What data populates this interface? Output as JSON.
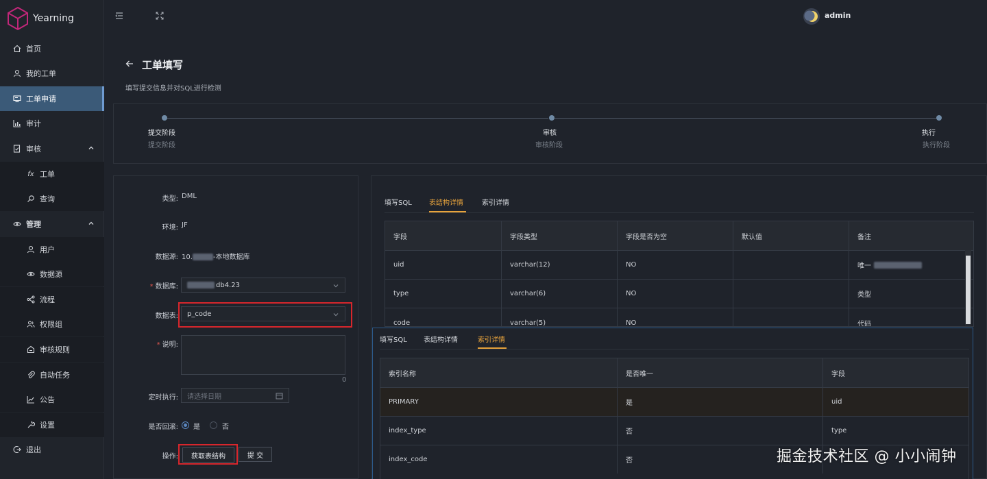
{
  "app": {
    "name": "Yearning"
  },
  "header": {
    "username": "admin"
  },
  "sidebar": {
    "items": [
      {
        "label": "首页",
        "icon": "home-icon"
      },
      {
        "label": "我的工单",
        "icon": "user-icon"
      },
      {
        "label": "工单申请",
        "icon": "monitor-icon",
        "active": true
      },
      {
        "label": "审计",
        "icon": "chart-icon"
      },
      {
        "label": "审核",
        "icon": "doc-check-icon",
        "expanded": true
      },
      {
        "label": "工单",
        "icon": "fx-icon",
        "sub": true
      },
      {
        "label": "查询",
        "icon": "search-icon",
        "sub": true
      },
      {
        "label": "管理",
        "icon": "eye-icon",
        "expanded": true
      },
      {
        "label": "用户",
        "icon": "user-icon",
        "sub": true
      },
      {
        "label": "数据源",
        "icon": "eye-icon",
        "sub": true
      },
      {
        "label": "流程",
        "icon": "flow-icon",
        "sub": true
      },
      {
        "label": "权限组",
        "icon": "group-icon",
        "sub": true
      },
      {
        "label": "审核规则",
        "icon": "rule-icon",
        "sub": true
      },
      {
        "label": "自动任务",
        "icon": "paperclip-icon",
        "sub": true
      },
      {
        "label": "公告",
        "icon": "chart-icon",
        "sub": true
      },
      {
        "label": "设置",
        "icon": "wrench-icon",
        "sub": true
      },
      {
        "label": "退出",
        "icon": "logout-icon"
      }
    ]
  },
  "page": {
    "title": "工单填写",
    "subtitle": "填写提交信息并对SQL进行检测"
  },
  "steps": [
    {
      "title": "提交阶段",
      "desc": "提交阶段"
    },
    {
      "title": "审核",
      "desc": "审核阶段"
    },
    {
      "title": "执行",
      "desc": "执行阶段"
    }
  ],
  "form": {
    "type_label": "类型:",
    "type_value": "DML",
    "env_label": "环境:",
    "env_value": "JF",
    "source_label": "数据源:",
    "source_prefix": "10.",
    "source_suffix": "-本地数据库",
    "db_label": "数据库:",
    "db_value_suffix": "db4.23",
    "table_label": "数据表:",
    "table_value": "p_code",
    "desc_label": "说明:",
    "desc_count": "0",
    "schedule_label": "定时执行:",
    "schedule_placeholder": "请选择日期",
    "rollback_label": "是否回滚:",
    "rollback_yes": "是",
    "rollback_no": "否",
    "action_label": "操作:",
    "fetch_button": "获取表结构",
    "submit_button": "提 交"
  },
  "tabs_main": {
    "tabs": [
      "填写SQL",
      "表结构详情",
      "索引详情"
    ],
    "active": 1
  },
  "structure_table": {
    "headers": [
      "字段",
      "字段类型",
      "字段是否为空",
      "默认值",
      "备注"
    ],
    "rows": [
      [
        "uid",
        "varchar(12)",
        "NO",
        "",
        "唯一"
      ],
      [
        "type",
        "varchar(6)",
        "NO",
        "",
        "类型"
      ],
      [
        "code",
        "varchar(5)",
        "NO",
        "",
        "代码"
      ]
    ]
  },
  "tabs_overlay": {
    "tabs": [
      "填写SQL",
      "表结构详情",
      "索引详情"
    ],
    "active": 2
  },
  "index_table": {
    "headers": [
      "索引名称",
      "是否唯一",
      "字段"
    ],
    "rows": [
      [
        "PRIMARY",
        "是",
        "uid"
      ],
      [
        "index_type",
        "否",
        "type"
      ],
      [
        "index_code",
        "否",
        ""
      ]
    ]
  },
  "watermark": "掘金技术社区 @ 小小闹钟"
}
